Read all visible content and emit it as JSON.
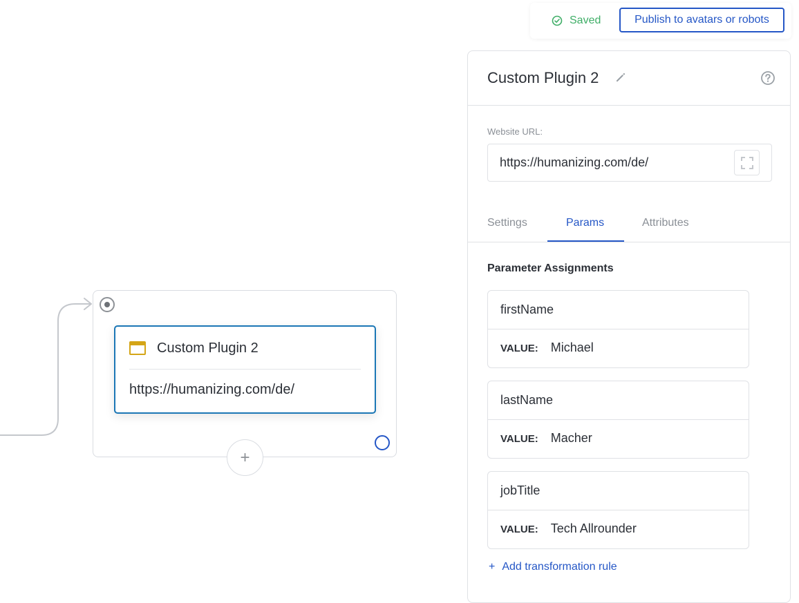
{
  "topbar": {
    "saved_label": "Saved",
    "publish_label": "Publish to avatars or robots"
  },
  "node": {
    "title": "Custom Plugin 2",
    "url": "https://humanizing.com/de/",
    "add_symbol": "+"
  },
  "panel": {
    "title": "Custom Plugin 2",
    "url_label": "Website URL:",
    "url_value": "https://humanizing.com/de/",
    "tabs": [
      {
        "label": "Settings",
        "active": false
      },
      {
        "label": "Params",
        "active": true
      },
      {
        "label": "Attributes",
        "active": false
      }
    ],
    "section_title": "Parameter Assignments",
    "params": [
      {
        "name": "firstName",
        "value_label": "VALUE:",
        "value": "Michael"
      },
      {
        "name": "lastName",
        "value_label": "VALUE:",
        "value": "Macher"
      },
      {
        "name": "jobTitle",
        "value_label": "VALUE:",
        "value": "Tech Allrounder"
      }
    ],
    "add_rule_symbol": "+",
    "add_rule_label": "Add transformation rule"
  },
  "colors": {
    "accent": "#2456c6",
    "saved_green": "#3fae67",
    "node_border": "#1a76b5",
    "plugin_icon": "#d4a516"
  }
}
